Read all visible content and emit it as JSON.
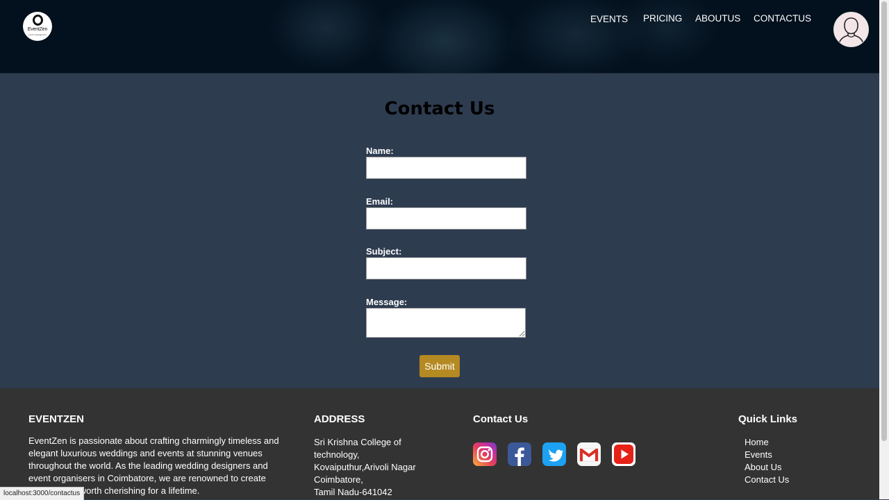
{
  "header": {
    "logo": {
      "brand": "EventZen",
      "tagline": "event management"
    },
    "nav": [
      "EVENTS",
      "PRICING",
      "ABOUTUS",
      "CONTACTUS"
    ]
  },
  "form": {
    "title": "Contact Us",
    "fields": [
      {
        "label": "Name:",
        "value": "",
        "placeholder": ""
      },
      {
        "label": "Email:",
        "value": "",
        "placeholder": ""
      },
      {
        "label": "Subject:",
        "value": "",
        "placeholder": ""
      },
      {
        "label": "Message:",
        "value": "",
        "placeholder": ""
      }
    ],
    "submit_label": "Submit"
  },
  "footer": {
    "about": {
      "heading": "EVENTZEN",
      "text": "EventZen is passionate about crafting charmingly timeless and elegant luxurious weddings and events at stunning venues throughout the world. As the leading wedding designers and event organisers in Coimbatore, we are renowned to create experiences worth cherishing for a lifetime."
    },
    "address": {
      "heading": "ADDRESS",
      "lines": [
        "Sri Krishna College of",
        "technology,",
        "Kovaiputhur,Arivoli Nagar",
        "Coimbatore,",
        "Tamil Nadu-641042"
      ]
    },
    "contact": {
      "heading": "Contact Us",
      "social_icons": [
        "instagram-icon",
        "facebook-icon",
        "twitter-icon",
        "gmail-icon",
        "youtube-icon"
      ]
    },
    "quick_links": {
      "heading": "Quick Links",
      "items": [
        "Home",
        "Events",
        "About Us",
        "Contact Us"
      ]
    }
  },
  "status_bar": {
    "url": "localhost:3000/contactus"
  },
  "colors": {
    "main_bg": "#2e3c50",
    "footer_bg": "#333333",
    "submit_bg": "#b58a22",
    "header_bg": "#03101d"
  }
}
